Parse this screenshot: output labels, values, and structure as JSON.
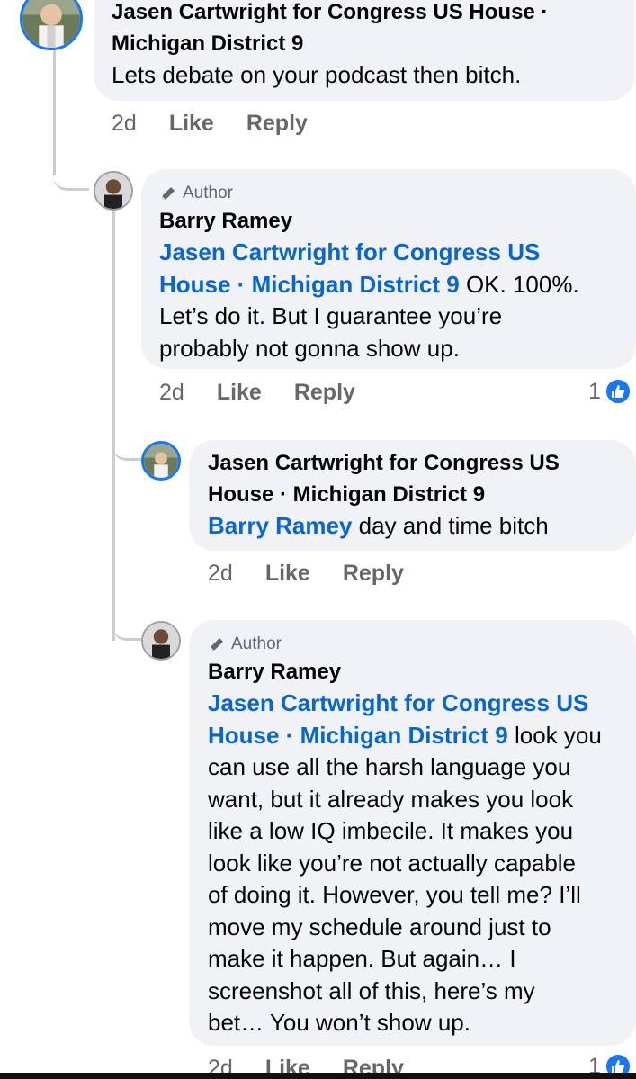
{
  "comments": [
    {
      "author": "Jasen Cartwright for Congress US House · Michigan District 9",
      "author_lines": [
        "Jasen Cartwright for Congress US House ·",
        "Michigan District 9"
      ],
      "text": "Lets debate on your podcast then bitch.",
      "time": "2d",
      "like": "Like",
      "reply": "Reply"
    },
    {
      "badge": "Author",
      "author": "Barry Ramey",
      "mention_lines": [
        "Jasen Cartwright for Congress US",
        "House · Michigan District 9"
      ],
      "text_after_mention": " OK. 100%.",
      "text_lines": [
        "Let’s do it. But I guarantee you’re",
        "probably not gonna show up."
      ],
      "time": "2d",
      "like": "Like",
      "reply": "Reply",
      "reaction_count": "1"
    },
    {
      "author_lines": [
        "Jasen Cartwright for Congress US",
        "House · Michigan District 9"
      ],
      "mention": "Barry Ramey",
      "text_after_mention": " day and time bitch",
      "time": "2d",
      "like": "Like",
      "reply": "Reply"
    },
    {
      "badge": "Author",
      "author": "Barry Ramey",
      "mention_lines": [
        "Jasen Cartwright for Congress US",
        "House · Michigan District 9"
      ],
      "text_after_mention": " look you",
      "text_lines": [
        "can use all the harsh language you",
        "want, but it already makes you look",
        "like a low IQ imbecile. It makes you",
        "look like you’re not actually capable",
        "of doing it. However, you tell me? I’ll",
        "move my schedule around just to",
        "make it happen. But again… I",
        "screenshot all of this, here’s my",
        "bet… You won’t show up."
      ],
      "time": "2d",
      "like": "Like",
      "reply": "Reply",
      "reaction_count": "1"
    }
  ],
  "icons": {
    "author_badge": "pencil-icon",
    "reaction": "thumbs-up-icon"
  },
  "colors": {
    "bubble": "#f0f2f5",
    "mention": "#0866d0",
    "muted": "#65676b",
    "like_blue": "#1877f2"
  }
}
